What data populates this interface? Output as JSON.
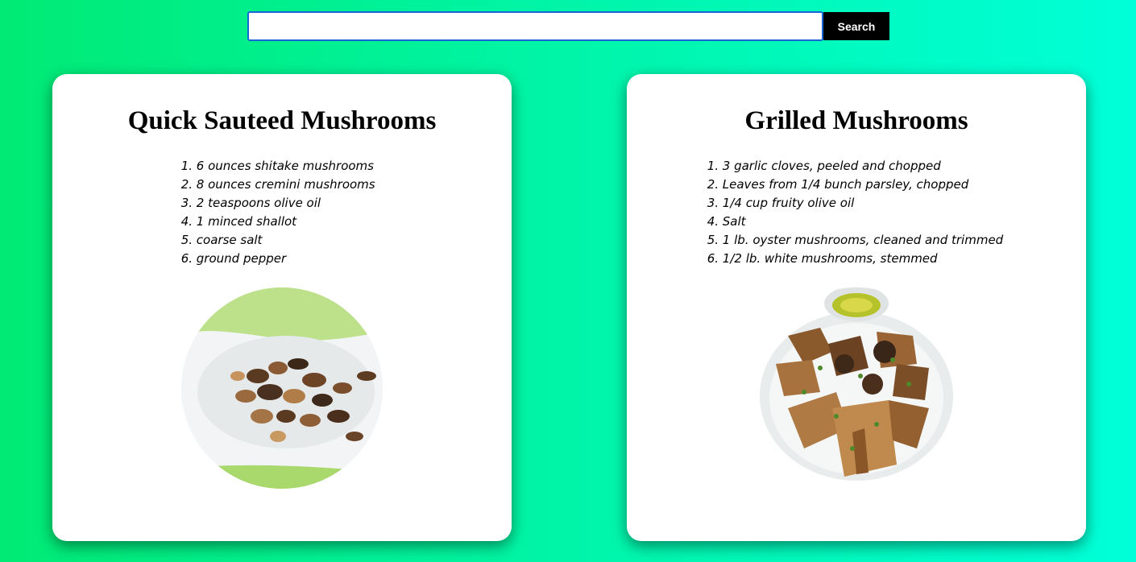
{
  "search": {
    "value": "",
    "placeholder": "",
    "button_label": "Search"
  },
  "recipes": [
    {
      "title": "Quick Sauteed Mushrooms",
      "ingredients": [
        "6 ounces shitake mushrooms",
        "8 ounces cremini mushrooms",
        "2 teaspoons olive oil",
        "1 minced shallot",
        "coarse salt",
        "ground pepper"
      ]
    },
    {
      "title": "Grilled Mushrooms",
      "ingredients": [
        "3 garlic cloves, peeled and chopped",
        "Leaves from 1/4 bunch parsley, chopped",
        "1/4 cup fruity olive oil",
        "Salt",
        "1 lb. oyster mushrooms, cleaned and trimmed",
        "1/2 lb. white mushrooms, stemmed"
      ]
    }
  ],
  "colors": {
    "background_start": "#00ea74",
    "background_end": "#00ffd8",
    "search_border": "#1a64d6",
    "button_bg": "#000000"
  }
}
